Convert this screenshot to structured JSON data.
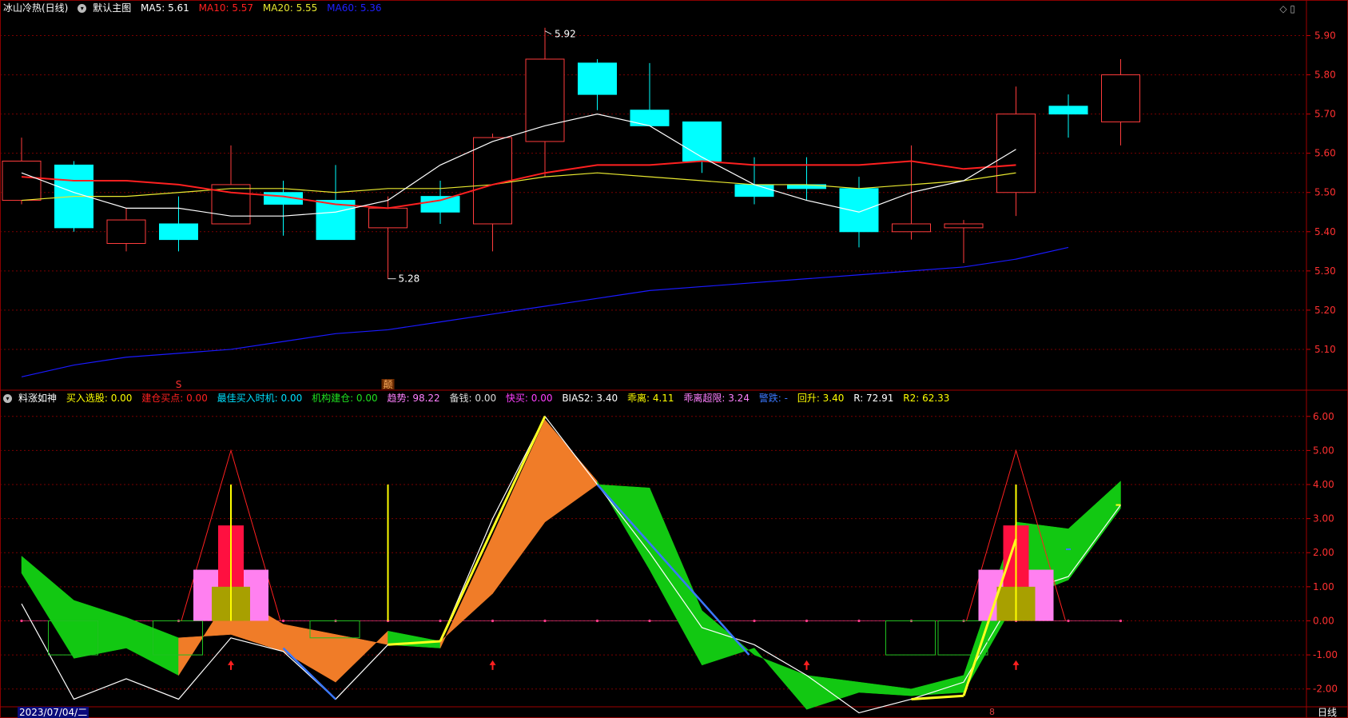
{
  "main_header": {
    "title": "冰山冷热(日线)",
    "template": "默认主图",
    "ma5": "MA5: 5.61",
    "ma10": "MA10: 5.57",
    "ma20": "MA20: 5.55",
    "ma60": "MA60: 5.36"
  },
  "sub_header": {
    "title": "料涨如神",
    "f1": "买入选股: 0.00",
    "f2": "建仓买点: 0.00",
    "f3": "最佳买入时机: 0.00",
    "f4": "机构建仓: 0.00",
    "f5": "趋势: 98.22",
    "f6": "备钱: 0.00",
    "f7": "快买: 0.00",
    "f8": "BIAS2: 3.40",
    "f9": "乖离: 4.11",
    "f10": "乖离超限: 3.24",
    "f11": "警跌: -",
    "f12": "回升: 3.40",
    "f13": "R: 72.91",
    "f14": "R2: 62.33"
  },
  "markers": {
    "s": "S",
    "d": "颠"
  },
  "annotations": {
    "high": "5.92",
    "low": "5.28"
  },
  "footer": {
    "date": "2023/07/04/二",
    "period": "日线",
    "mark": "8"
  },
  "colors": {
    "up": "#ff3c3c",
    "down": "#00ffff",
    "ma5": "#ffffff",
    "ma10": "#ff2020",
    "ma20": "#e8e830",
    "ma60": "#1a1aff",
    "grid": "#7a0000"
  },
  "chart_data": [
    {
      "type": "candlestick",
      "ylim": [
        5.0,
        5.95
      ],
      "yticks": [
        "5.90",
        "5.80",
        "5.70",
        "5.60",
        "5.50",
        "5.40",
        "5.30",
        "5.20",
        "5.10"
      ],
      "candles": [
        {
          "o": 5.48,
          "h": 5.64,
          "l": 5.47,
          "c": 5.58
        },
        {
          "o": 5.57,
          "h": 5.58,
          "l": 5.4,
          "c": 5.41
        },
        {
          "o": 5.37,
          "h": 5.46,
          "l": 5.35,
          "c": 5.43
        },
        {
          "o": 5.42,
          "h": 5.49,
          "l": 5.35,
          "c": 5.38
        },
        {
          "o": 5.42,
          "h": 5.62,
          "l": 5.42,
          "c": 5.52
        },
        {
          "o": 5.5,
          "h": 5.53,
          "l": 5.39,
          "c": 5.47
        },
        {
          "o": 5.48,
          "h": 5.57,
          "l": 5.38,
          "c": 5.38
        },
        {
          "o": 5.41,
          "h": 5.49,
          "l": 5.28,
          "c": 5.46
        },
        {
          "o": 5.49,
          "h": 5.53,
          "l": 5.42,
          "c": 5.45
        },
        {
          "o": 5.42,
          "h": 5.65,
          "l": 5.35,
          "c": 5.64
        },
        {
          "o": 5.63,
          "h": 5.92,
          "l": 5.54,
          "c": 5.84
        },
        {
          "o": 5.83,
          "h": 5.84,
          "l": 5.71,
          "c": 5.75
        },
        {
          "o": 5.71,
          "h": 5.83,
          "l": 5.67,
          "c": 5.67
        },
        {
          "o": 5.68,
          "h": 5.68,
          "l": 5.55,
          "c": 5.58
        },
        {
          "o": 5.52,
          "h": 5.59,
          "l": 5.47,
          "c": 5.49
        },
        {
          "o": 5.52,
          "h": 5.59,
          "l": 5.48,
          "c": 5.51
        },
        {
          "o": 5.51,
          "h": 5.54,
          "l": 5.36,
          "c": 5.4
        },
        {
          "o": 5.4,
          "h": 5.62,
          "l": 5.38,
          "c": 5.42
        },
        {
          "o": 5.41,
          "h": 5.43,
          "l": 5.32,
          "c": 5.42
        },
        {
          "o": 5.5,
          "h": 5.77,
          "l": 5.44,
          "c": 5.7
        },
        {
          "o": 5.72,
          "h": 5.75,
          "l": 5.64,
          "c": 5.7
        },
        {
          "o": 5.68,
          "h": 5.84,
          "l": 5.62,
          "c": 5.8
        }
      ],
      "ma5": [
        5.55,
        5.5,
        5.46,
        5.46,
        5.44,
        5.44,
        5.45,
        5.48,
        5.57,
        5.63,
        5.67,
        5.7,
        5.67,
        5.59,
        5.52,
        5.48,
        5.45,
        5.5,
        5.53,
        5.61
      ],
      "ma10": [
        5.54,
        5.53,
        5.53,
        5.52,
        5.5,
        5.49,
        5.47,
        5.46,
        5.48,
        5.52,
        5.55,
        5.57,
        5.57,
        5.58,
        5.57,
        5.57,
        5.57,
        5.58,
        5.56,
        5.57
      ],
      "ma20": [
        5.48,
        5.49,
        5.49,
        5.5,
        5.51,
        5.51,
        5.5,
        5.51,
        5.51,
        5.52,
        5.54,
        5.55,
        5.54,
        5.53,
        5.52,
        5.52,
        5.51,
        5.52,
        5.53,
        5.55
      ],
      "ma60": [
        5.03,
        5.06,
        5.08,
        5.09,
        5.1,
        5.12,
        5.14,
        5.15,
        5.17,
        5.19,
        5.21,
        5.23,
        5.25,
        5.26,
        5.27,
        5.28,
        5.29,
        5.3,
        5.31,
        5.33,
        5.36
      ]
    },
    {
      "type": "indicator",
      "ylim": [
        -2.5,
        6.3
      ],
      "yticks": [
        "6.00",
        "5.00",
        "4.00",
        "3.00",
        "2.00",
        "1.00",
        "0.00",
        "-1.00",
        "-2.00"
      ],
      "white_line": [
        0.5,
        -2.3,
        -1.7,
        -2.3,
        -0.5,
        -0.9,
        -2.3,
        -0.7,
        -0.6,
        3.0,
        6.0,
        4.0,
        2.0,
        -0.2,
        -0.7,
        -1.6,
        -2.7,
        -2.3,
        -1.8,
        0.8,
        1.3,
        3.4
      ],
      "orange_a": [
        1.9,
        0.6,
        0.1,
        -0.5,
        -0.4,
        -0.9,
        -1.8,
        -0.3,
        -0.6,
        0.8,
        2.9,
        4.0,
        3.9,
        0.3,
        -1.0,
        -1.6,
        -1.8,
        -2.0,
        -1.6,
        2.9,
        2.7,
        4.1
      ],
      "orange_b": [
        1.4,
        -1.1,
        -0.8,
        -1.6,
        0.8,
        -0.1,
        -0.4,
        -0.7,
        -0.8,
        2.5,
        5.9,
        4.1,
        1.5,
        -1.3,
        -0.8,
        -2.6,
        -2.1,
        -2.2,
        -2.1,
        0.6,
        1.2,
        3.3
      ],
      "spikes_x": [
        4,
        7,
        19
      ],
      "arrows_x": [
        4,
        9,
        15,
        19
      ]
    }
  ]
}
